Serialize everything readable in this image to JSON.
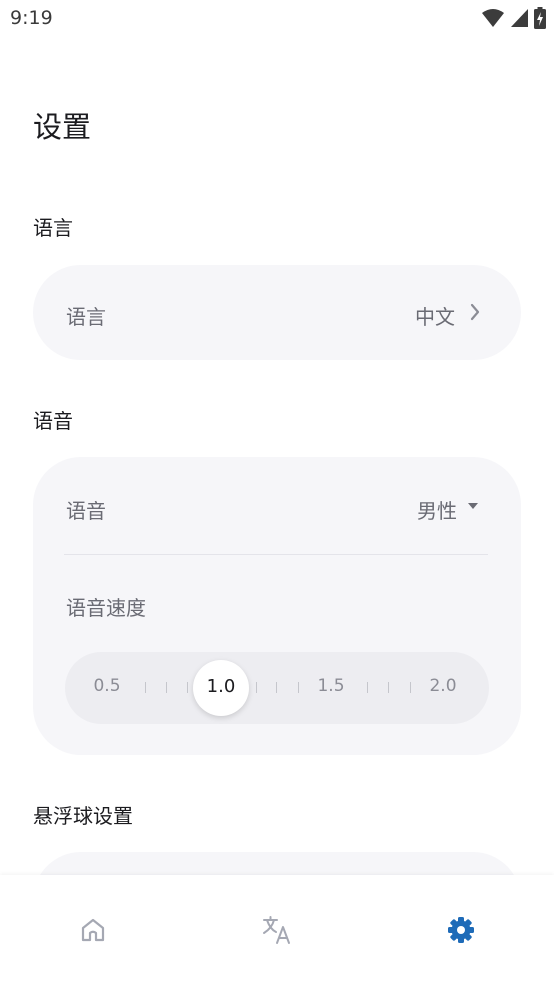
{
  "status_bar": {
    "time": "9:19",
    "icons": [
      "wifi-icon",
      "signal-icon",
      "battery-charging-icon"
    ]
  },
  "page": {
    "title": "设置"
  },
  "language_section": {
    "title": "语言",
    "row": {
      "label": "语言",
      "value": "中文",
      "trailing_icon": "chevron-right-icon"
    }
  },
  "voice_section": {
    "title": "语音",
    "voice_row": {
      "label": "语音",
      "value": "男性",
      "trailing_icon": "caret-down-icon"
    },
    "speed": {
      "label": "语音速度",
      "labels": [
        "0.5",
        "1.5",
        "2.0"
      ],
      "current_label": "1.0",
      "min": 0.5,
      "max": 2.0,
      "value": 1.0
    }
  },
  "floating_ball_section": {
    "title": "悬浮球设置"
  },
  "bottom_nav": {
    "items": [
      {
        "name": "home",
        "icon": "home-icon",
        "active": false
      },
      {
        "name": "translate",
        "icon": "translate-icon",
        "active": false
      },
      {
        "name": "settings",
        "icon": "gear-icon",
        "active": true
      }
    ],
    "active_color": "#1e6bb8",
    "inactive_color": "#a5a8b3"
  }
}
